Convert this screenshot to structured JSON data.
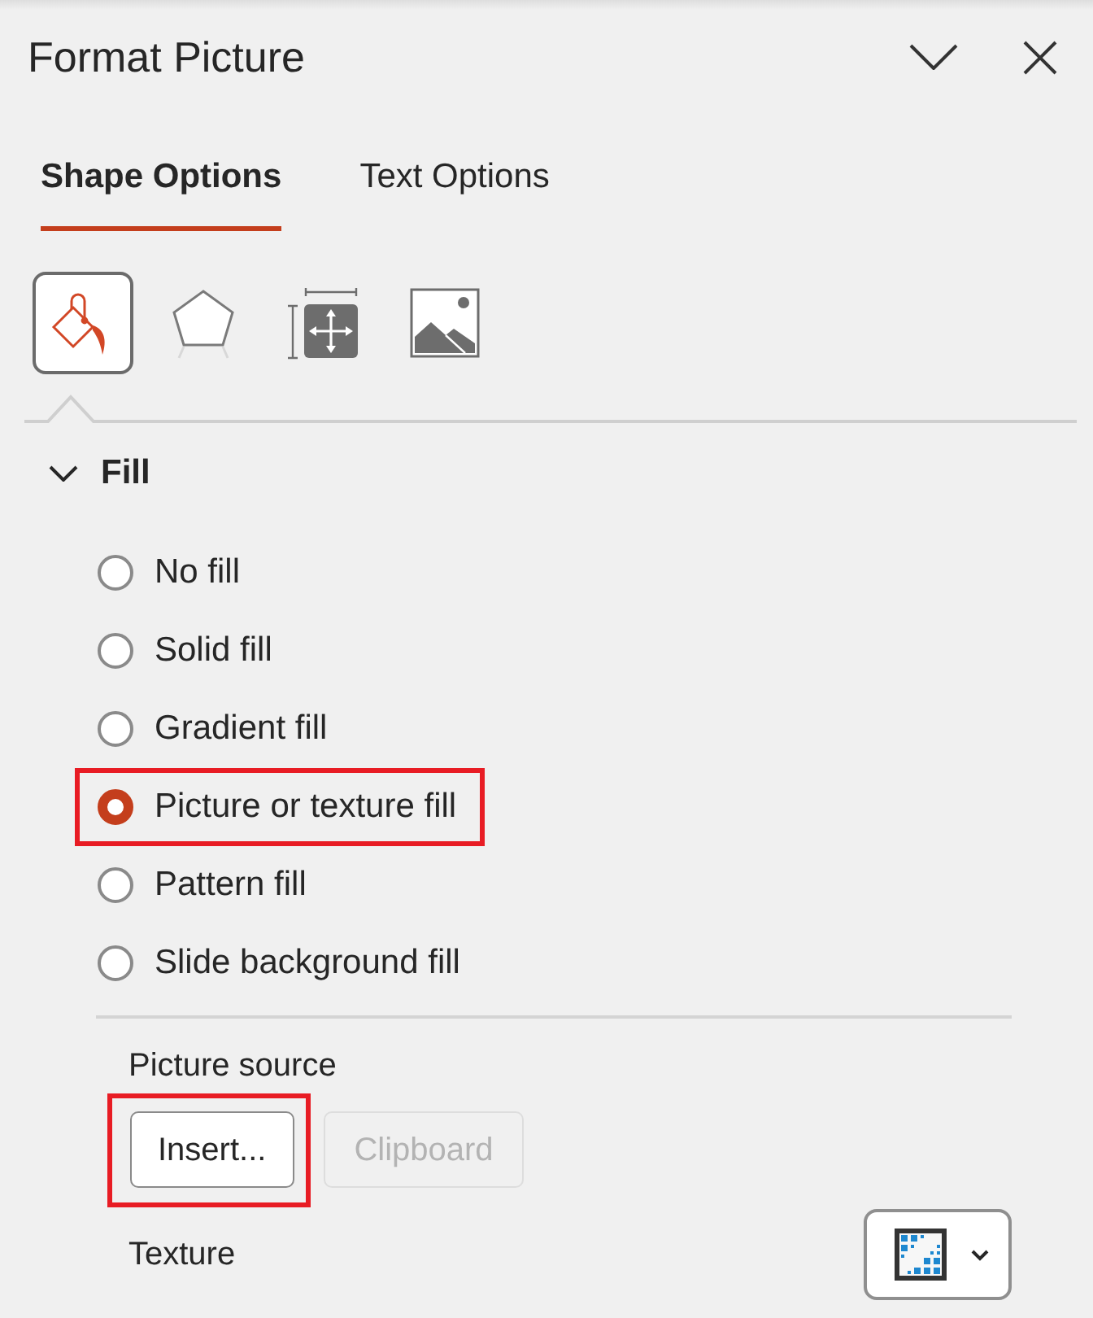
{
  "panel": {
    "title": "Format Picture"
  },
  "tabs": [
    {
      "label": "Shape Options",
      "selected": true
    },
    {
      "label": "Text Options",
      "selected": false
    }
  ],
  "icon_tabs": [
    {
      "kind": "fill",
      "selected": true
    },
    {
      "kind": "effects",
      "selected": false
    },
    {
      "kind": "layout",
      "selected": false
    },
    {
      "kind": "picture",
      "selected": false
    }
  ],
  "fill_section": {
    "title": "Fill",
    "expanded": true,
    "options": [
      {
        "label": "No fill",
        "selected": false,
        "highlighted": false
      },
      {
        "label": "Solid fill",
        "selected": false,
        "highlighted": false
      },
      {
        "label": "Gradient fill",
        "selected": false,
        "highlighted": false
      },
      {
        "label": "Picture or texture fill",
        "selected": true,
        "highlighted": true
      },
      {
        "label": "Pattern fill",
        "selected": false,
        "highlighted": false
      },
      {
        "label": "Slide background fill",
        "selected": false,
        "highlighted": false
      }
    ],
    "picture_source": {
      "label": "Picture source",
      "buttons": [
        {
          "label": "Insert...",
          "disabled": false,
          "highlighted": true
        },
        {
          "label": "Clipboard",
          "disabled": true,
          "highlighted": false
        }
      ]
    },
    "texture": {
      "label": "Texture"
    }
  }
}
